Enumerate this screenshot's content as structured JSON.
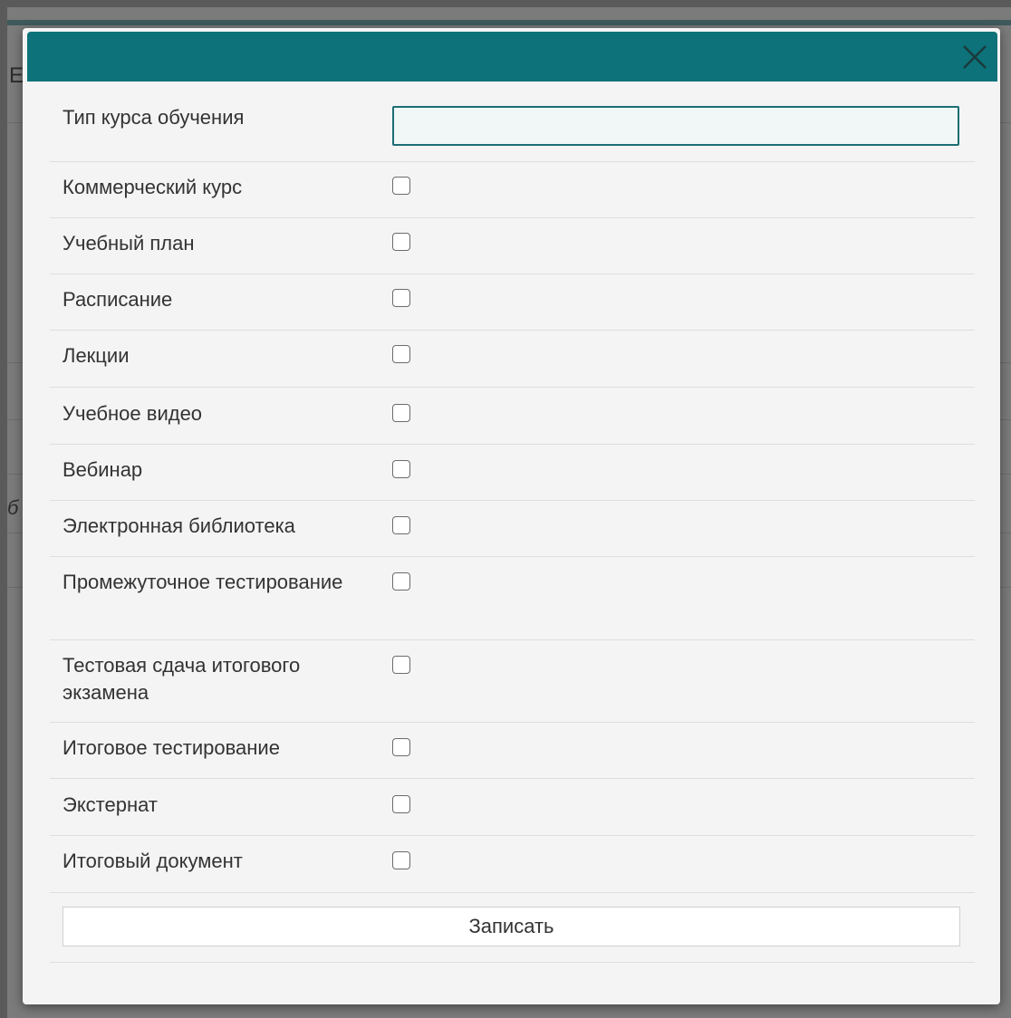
{
  "background": {
    "heading_letter": "E",
    "italic_letter": "б"
  },
  "dialog": {
    "close_label": "close",
    "header_color": "#0d7279",
    "fields": {
      "course_type": {
        "label": "Тип курса обучения",
        "value": "",
        "placeholder": ""
      }
    },
    "options": [
      {
        "label": "Коммерческий курс",
        "checked": false
      },
      {
        "label": "Учебный план",
        "checked": false
      },
      {
        "label": "Расписание",
        "checked": false
      },
      {
        "label": "Лекции",
        "checked": false
      },
      {
        "label": "Учебное видео",
        "checked": false
      },
      {
        "label": "Вебинар",
        "checked": false
      },
      {
        "label": "Электронная библиотека",
        "checked": false
      },
      {
        "label": "Промежуточное тестирование",
        "checked": false
      },
      {
        "label": "Тестовая сдача итогового экзамена",
        "checked": false
      },
      {
        "label": "Итоговое тестирование",
        "checked": false
      },
      {
        "label": "Экстернат",
        "checked": false
      },
      {
        "label": "Итоговый документ",
        "checked": false
      }
    ],
    "submit_label": "Записать"
  }
}
